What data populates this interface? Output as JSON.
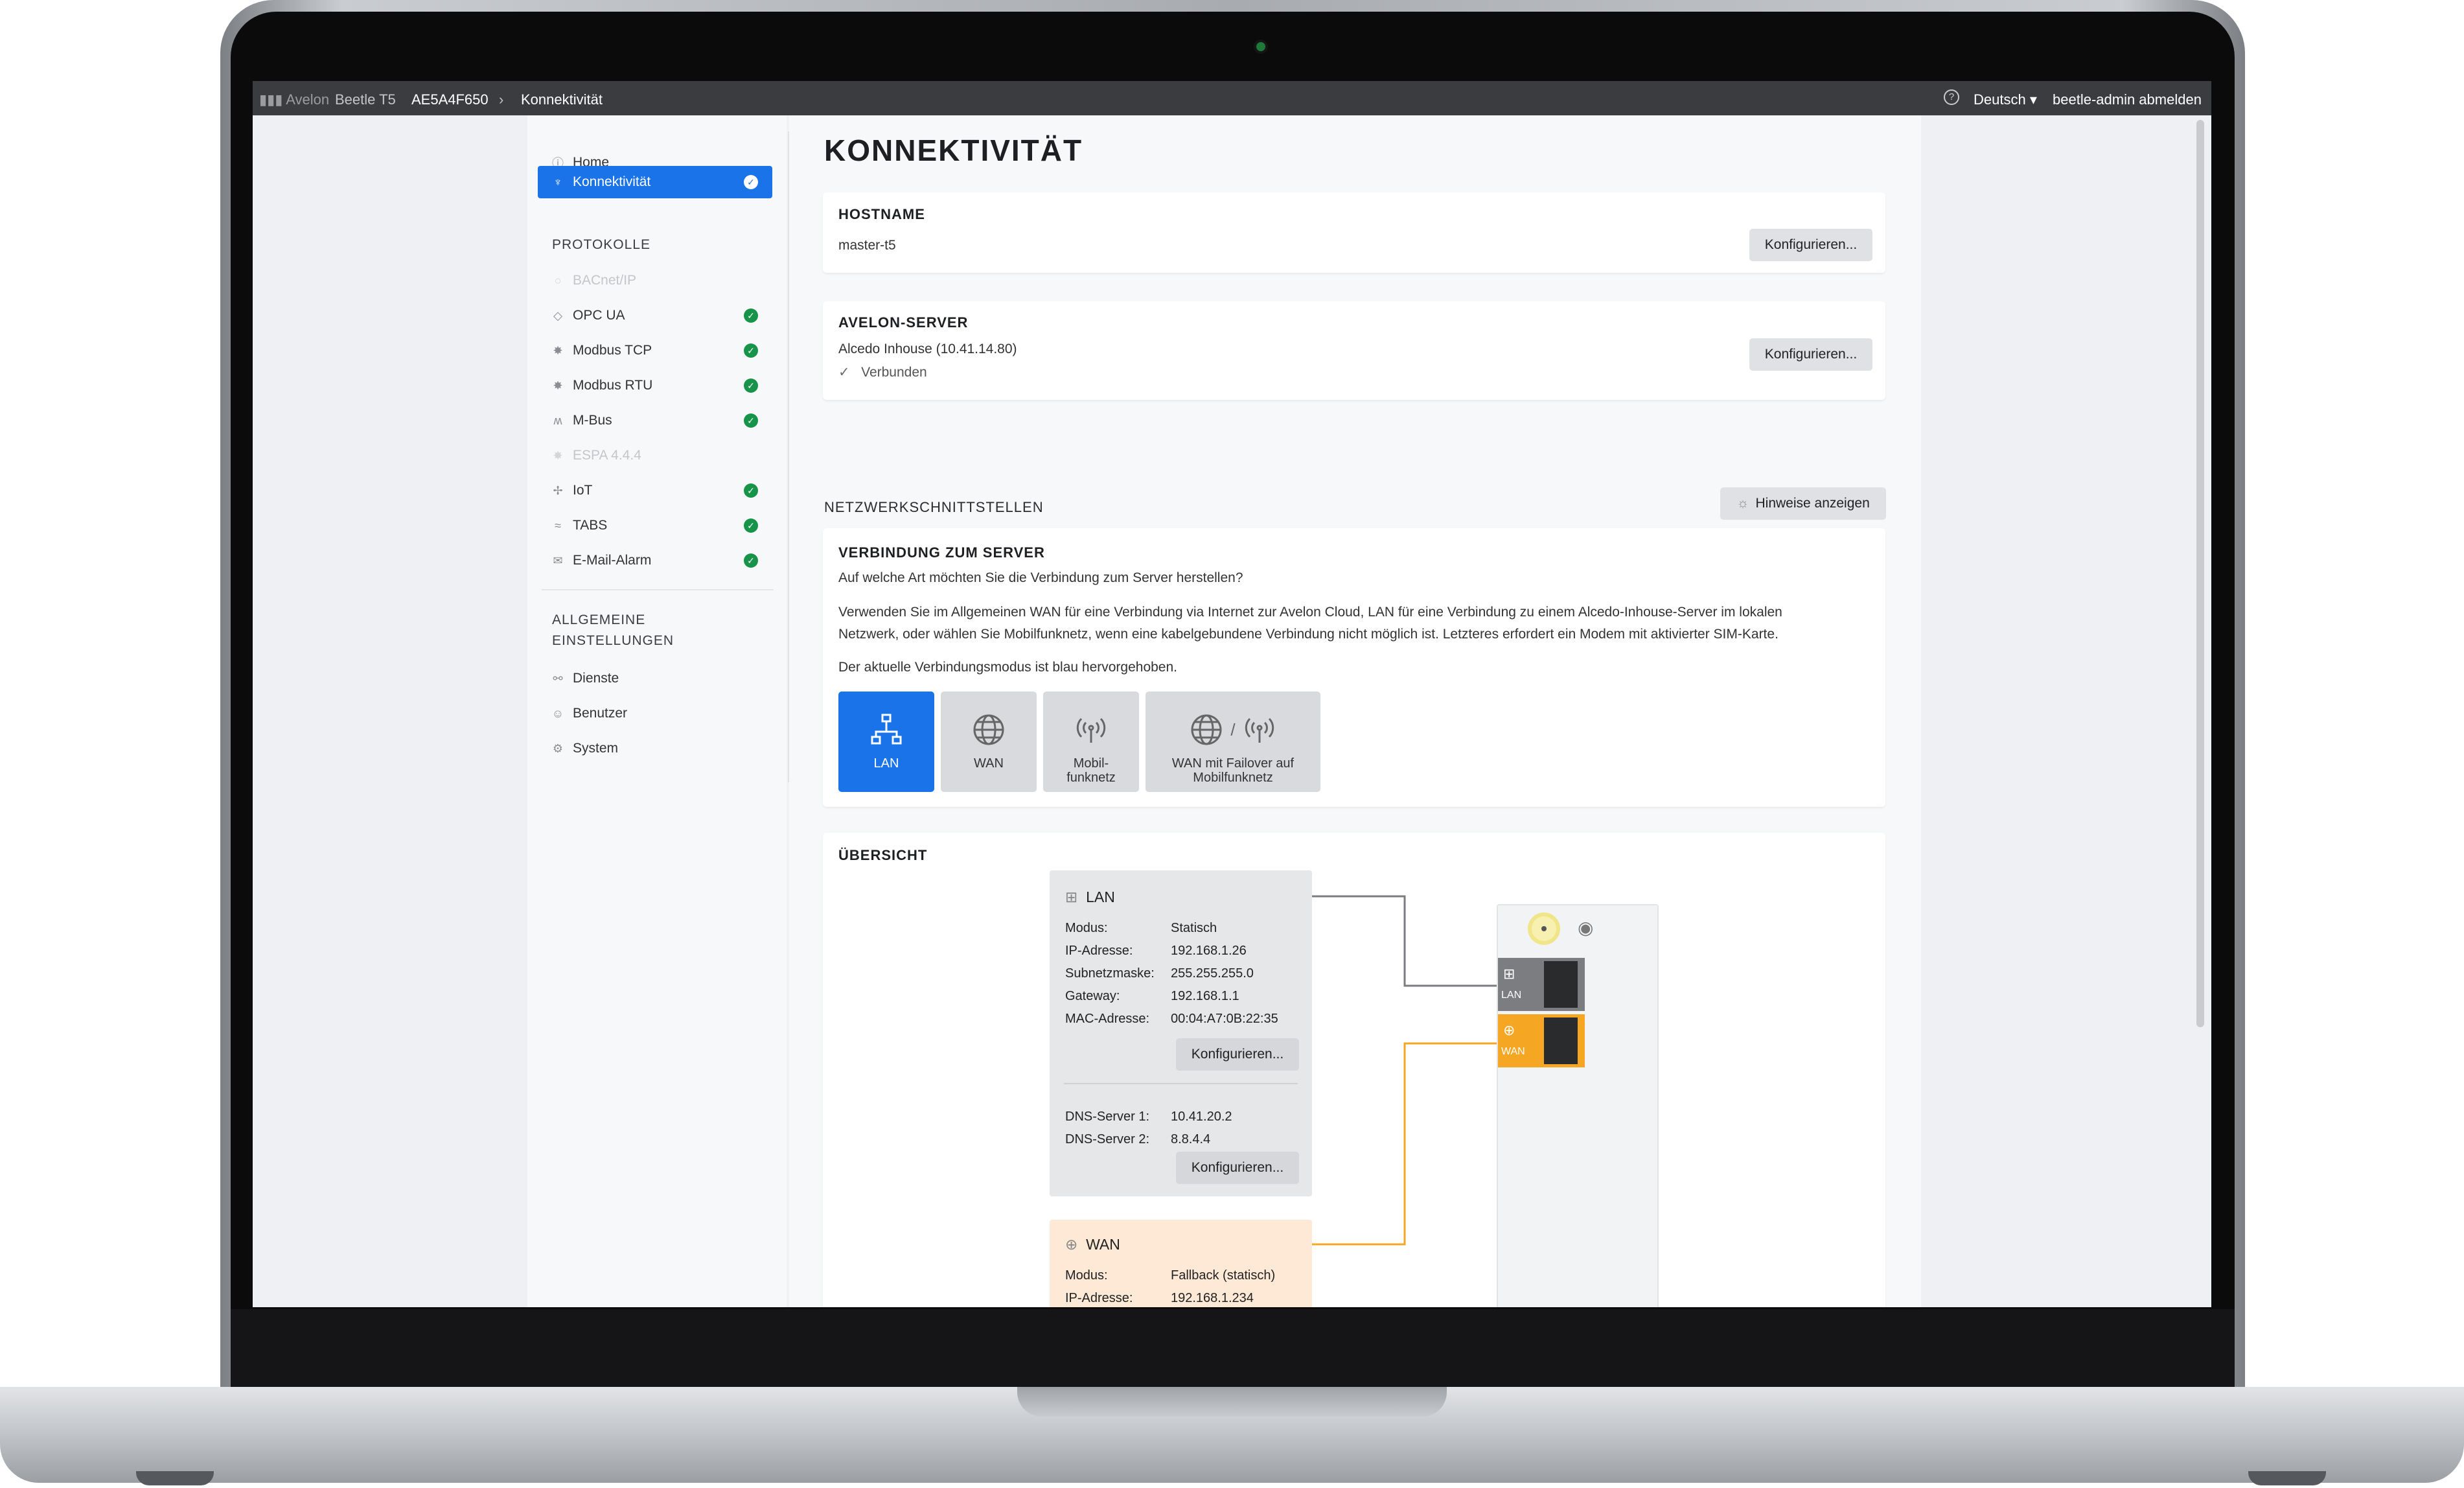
{
  "topbar": {
    "brand": "Avelon",
    "device": "Beetle T5",
    "serial": "AE5A4F650",
    "breadcrumb_sep": "›",
    "current": "Konnektivität",
    "help_icon": "help-circle-icon",
    "language": "Deutsch",
    "logout": "beetle-admin abmelden"
  },
  "sidebar": {
    "home": "Home",
    "active": "Konnektivität",
    "protocols_heading": "PROTOKOLLE",
    "protocols": [
      {
        "label": "BACnet/IP",
        "enabled": false,
        "checked": false
      },
      {
        "label": "OPC UA",
        "enabled": true,
        "checked": true
      },
      {
        "label": "Modbus TCP",
        "enabled": true,
        "checked": true
      },
      {
        "label": "Modbus RTU",
        "enabled": true,
        "checked": true
      },
      {
        "label": "M-Bus",
        "enabled": true,
        "checked": true
      },
      {
        "label": "ESPA 4.4.4",
        "enabled": false,
        "checked": false
      },
      {
        "label": "IoT",
        "enabled": true,
        "checked": true
      },
      {
        "label": "TABS",
        "enabled": true,
        "checked": true
      },
      {
        "label": "E-Mail-Alarm",
        "enabled": true,
        "checked": true
      }
    ],
    "general_heading_1": "ALLGEMEINE",
    "general_heading_2": "EINSTELLUNGEN",
    "general": [
      "Dienste",
      "Benutzer",
      "System"
    ]
  },
  "page": {
    "title": "KONNEKTIVITÄT",
    "configure_label": "Konfigurieren...",
    "hostname": {
      "title": "HOSTNAME",
      "value": "master-t5"
    },
    "server": {
      "title": "AVELON-SERVER",
      "value": "Alcedo Inhouse (10.41.14.80)",
      "status": "Verbunden"
    },
    "interfaces": {
      "title": "NETZWERKSCHNITTSTELLEN",
      "hints_button": "Hinweise anzeigen"
    },
    "connection": {
      "title": "VERBINDUNG ZUM SERVER",
      "question": "Auf welche Art möchten Sie die Verbindung zum Server herstellen?",
      "desc_1": "Verwenden Sie im Allgemeinen WAN für eine Verbindung via Internet zur Avelon Cloud, LAN für eine Verbindung zu einem Alcedo-Inhouse-Server im lokalen",
      "desc_2": "Netzwerk, oder wählen Sie Mobilfunknetz, wenn eine kabelgebundene Verbindung nicht möglich ist. Letzteres erfordert ein Modem mit aktivierter SIM-Karte.",
      "current_note": "Der aktuelle Verbindungsmodus ist blau hervorgehoben.",
      "modes": [
        {
          "l1": "LAN",
          "l2": ""
        },
        {
          "l1": "WAN",
          "l2": ""
        },
        {
          "l1": "Mobil-",
          "l2": "funknetz"
        },
        {
          "l1": "WAN mit Failover auf",
          "l2": "Mobilfunknetz"
        }
      ],
      "mode_separator": "/"
    },
    "overview": {
      "title": "ÜBERSICHT",
      "lan": {
        "title": "LAN",
        "rows": [
          {
            "k": "Modus:",
            "v": "Statisch"
          },
          {
            "k": "IP-Adresse:",
            "v": "192.168.1.26"
          },
          {
            "k": "Subnetzmaske:",
            "v": "255.255.255.0"
          },
          {
            "k": "Gateway:",
            "v": "192.168.1.1"
          },
          {
            "k": "MAC-Adresse:",
            "v": "00:04:A7:0B:22:35"
          }
        ],
        "dns": [
          {
            "k": "DNS-Server 1:",
            "v": "10.41.20.2"
          },
          {
            "k": "DNS-Server 2:",
            "v": "8.8.4.4"
          }
        ]
      },
      "wan": {
        "title": "WAN",
        "rows": [
          {
            "k": "Modus:",
            "v": "Fallback (statisch)"
          },
          {
            "k": "IP-Adresse:",
            "v": "192.168.1.234"
          }
        ]
      },
      "device_ports": {
        "lan": "LAN",
        "wan": "WAN"
      }
    }
  },
  "colors": {
    "accent": "#1a73e8",
    "success": "#17944a",
    "wan": "#f5a623",
    "wan_bg": "#fde9d6",
    "lan_line": "#7a7c80"
  }
}
